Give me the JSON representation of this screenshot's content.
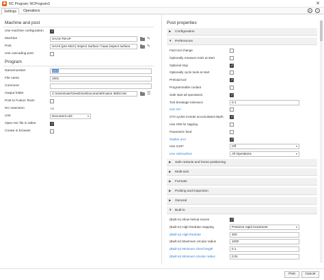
{
  "window": {
    "title": "NC Program: NCProgram3",
    "close_label": "✕"
  },
  "tabs": [
    {
      "label": "Settings"
    },
    {
      "label": "Operations"
    }
  ],
  "left": {
    "machine_section_title": "Machine and post",
    "use_machine_config": {
      "label": "Use machine configuration",
      "checked": true
    },
    "machine": {
      "label": "Machine",
      "value": "HAAS-TM-1P"
    },
    "post": {
      "label": "Post",
      "value": "HAAS (pre-NGC) Inspect Surface / haas inspect surface"
    },
    "use_cascading_post": {
      "label": "Use cascading post",
      "checked": false
    },
    "program_section_title": "Program",
    "name_number": {
      "label": "Name/number",
      "value": "1001"
    },
    "file_name": {
      "label": "File name",
      "value": "1001"
    },
    "comment": {
      "label": "Comment",
      "value": ""
    },
    "output_folder": {
      "label": "Output folder",
      "value": "C:\\Users\\user\\OneDrive\\Documents\\Fusion 360\\CAM"
    },
    "post_to_fusion_team": {
      "label": "Post to Fusion Team",
      "checked": false
    },
    "nc_extension": {
      "label": "NC extension",
      "value": ".nc"
    },
    "unit": {
      "label": "Unit",
      "value": "Document unit"
    },
    "open_nc_in_editor": {
      "label": "Open NC file in editor",
      "checked": true
    },
    "create_in_browser": {
      "label": "Create in browser",
      "checked": false
    }
  },
  "right": {
    "title": "Post properties",
    "groups": {
      "configuration": "Configuration",
      "preferences": "Preferences",
      "safe_retracts": "Safe retracts and home positioning",
      "multi_axis": "Multi-axis",
      "formats": "Formats",
      "probing": "Probing and inspection",
      "general": "General",
      "builtin": "Built-in"
    },
    "preferences": [
      {
        "label": "Fast tool change",
        "type": "checkbox",
        "checked": false,
        "blue": false
      },
      {
        "label": "Optionally measure tools at start",
        "type": "checkbox",
        "checked": false,
        "blue": false
      },
      {
        "label": "Optional stop",
        "type": "checkbox",
        "checked": true,
        "blue": false
      },
      {
        "label": "Optionally cycle tools at start",
        "type": "checkbox",
        "checked": false,
        "blue": false
      },
      {
        "label": "Preload tool",
        "type": "checkbox",
        "checked": true,
        "blue": false
      },
      {
        "label": "Programmable coolant",
        "type": "checkbox",
        "checked": false,
        "blue": false
      },
      {
        "label": "Safe start all operations",
        "type": "checkbox",
        "checked": true,
        "blue": false
      },
      {
        "label": "Tool breakage tolerance",
        "type": "text",
        "value": "0.1",
        "blue": false
      },
      {
        "label": "Use GO",
        "type": "checkbox",
        "checked": false,
        "blue": true
      },
      {
        "label": "G73 cycles include accumulated depth",
        "type": "checkbox",
        "checked": true,
        "blue": false
      },
      {
        "label": "Use G95 for tapping",
        "type": "checkbox",
        "checked": false,
        "blue": false
      },
      {
        "label": "Parametric feed",
        "type": "checkbox",
        "checked": false,
        "blue": false
      },
      {
        "label": "Radius arcs",
        "type": "checkbox",
        "checked": true,
        "blue": true
      },
      {
        "label": "Use G187",
        "type": "dropdown",
        "value": "Off",
        "blue": false
      },
      {
        "label": "Use subroutines",
        "type": "dropdown",
        "value": "All Operations",
        "blue": true
      }
    ],
    "builtin": [
      {
        "label": "(Built-in) Allow helical moves",
        "type": "checkbox",
        "checked": true,
        "blue": false
      },
      {
        "label": "(Built-in) High feedrate mapping",
        "type": "dropdown",
        "value": "Preserve rapid movement",
        "blue": false
      },
      {
        "label": "(Built-in) High feedrate",
        "type": "text",
        "value": "400",
        "blue": true
      },
      {
        "label": "(Built-in) Maximum circular radius",
        "type": "text",
        "value": "1000",
        "blue": false
      },
      {
        "label": "(Built-in) Minimum chord length",
        "type": "text",
        "value": "0.1",
        "blue": true
      },
      {
        "label": "(Built-in) Minimum circular radius",
        "type": "text",
        "value": "0.01",
        "blue": true
      }
    ]
  },
  "footer": {
    "post_label": "Post",
    "cancel_label": "Cancel"
  },
  "colors": {
    "accent": "#2a7bd3",
    "selection": "#3f7fd6",
    "logo": "#e8641e"
  }
}
